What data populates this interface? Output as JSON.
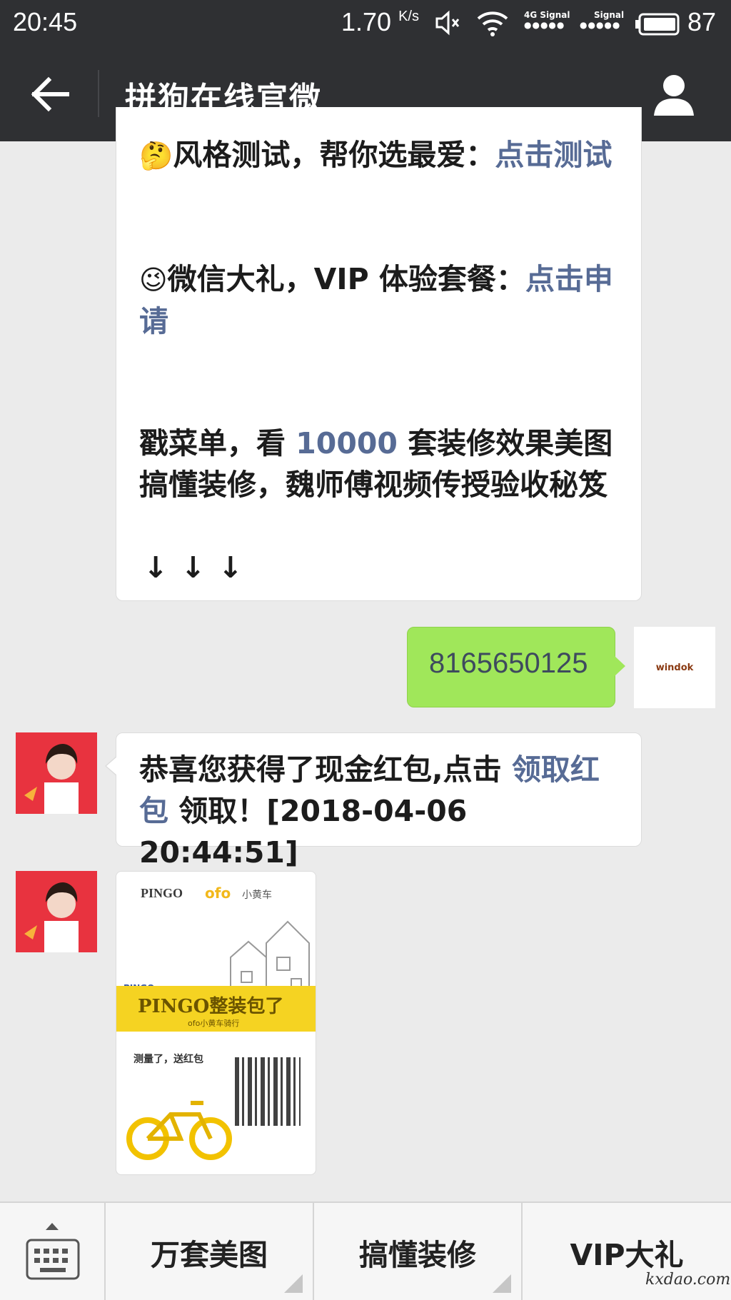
{
  "status_bar": {
    "time": "20:45",
    "speed": "1.70",
    "speed_unit": "K/s",
    "net_label_1": "4G Signal",
    "net_label_2": "Signal",
    "battery": "87"
  },
  "header": {
    "title": "拼狗在线官微"
  },
  "messages": {
    "m1": {
      "line1_emoji": "🤔",
      "line1_text": "风格测试，帮你选最爱：",
      "line1_link": "点击测试",
      "line2_emoji": "😉",
      "line2_text": "微信大礼，VIP 体验套餐：",
      "line2_link": "点击申请",
      "line3_a": "戳菜单，看 ",
      "line3_num": "10000",
      "line3_b": " 套装修效果美图搞懂装修，魏师傅视频传授验收秘笈",
      "arrows": "↓↓↓"
    },
    "m2": {
      "text": "8165650125",
      "sender_avatar_text": "windok"
    },
    "m3": {
      "text_a": "恭喜您获得了现金红包,点击 ",
      "link": "领取红包",
      "text_b": " 领取！[2018-04-06 20:44:51]"
    },
    "m4": {
      "poster_brand": "PINGO",
      "poster_partner": "ofo",
      "poster_partner_cn": "小黄车",
      "poster_sub": "PINGO",
      "poster_banner": "PINGO整装包了",
      "poster_banner_sub": "ofo小黄车骑行",
      "poster_bottom": "测量了，送红包"
    }
  },
  "bottom_menu": {
    "items": [
      "万套美图",
      "搞懂装修",
      "VIP大礼"
    ]
  },
  "watermark": "kxdao.com"
}
